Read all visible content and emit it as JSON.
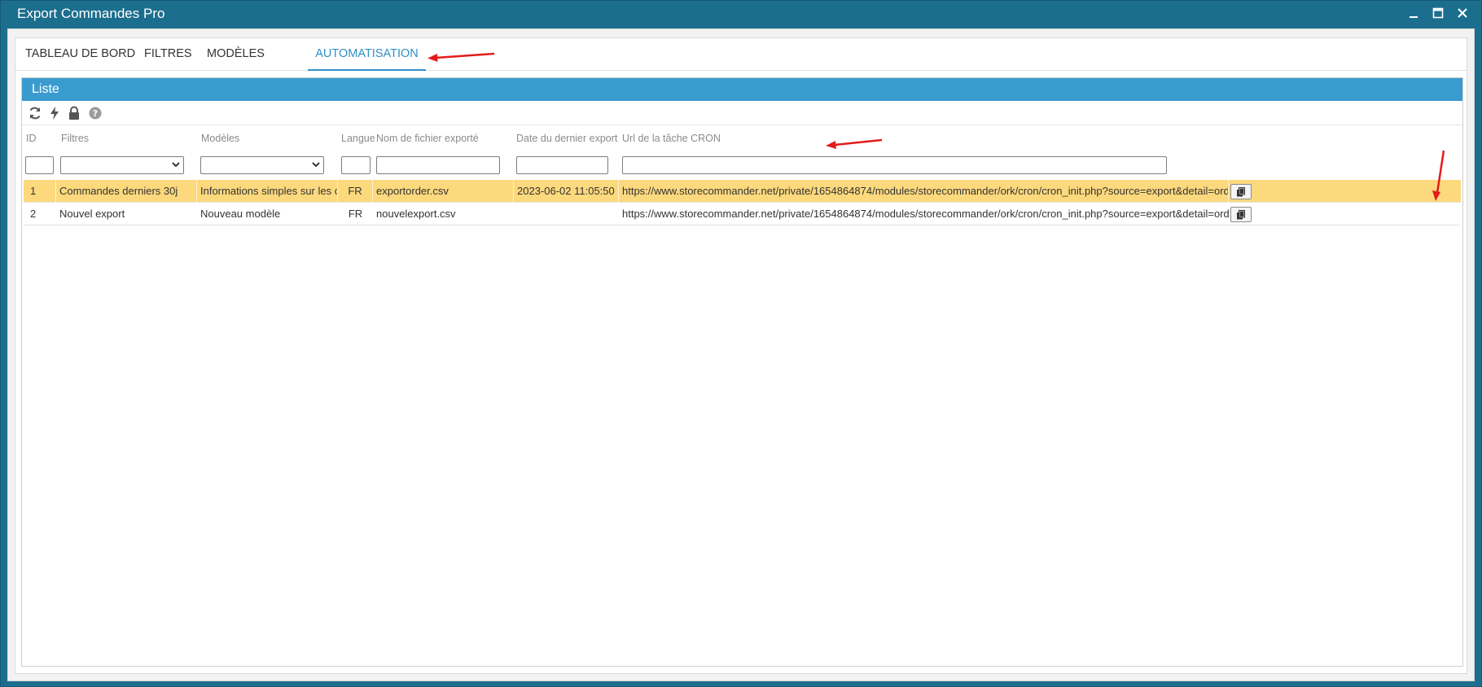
{
  "window": {
    "title": "Export Commandes Pro"
  },
  "tabs": [
    {
      "label": "TABLEAU DE BORD"
    },
    {
      "label": "FILTRES"
    },
    {
      "label": "MODÈLES"
    },
    {
      "label": "AUTOMATISATION"
    }
  ],
  "active_tab": "AUTOMATISATION",
  "liste": {
    "title": "Liste"
  },
  "toolbar": {
    "icons": [
      "refresh-icon",
      "lightning-icon",
      "lock-icon",
      "help-icon"
    ]
  },
  "columns": [
    {
      "label": "ID"
    },
    {
      "label": "Filtres"
    },
    {
      "label": "Modèles"
    },
    {
      "label": "Langue"
    },
    {
      "label": "Nom de fichier exporté"
    },
    {
      "label": "Date du dernier export"
    },
    {
      "label": "Url de la tâche CRON"
    }
  ],
  "rows": [
    {
      "id": "1",
      "filtre": "Commandes derniers 30j",
      "modele": "Informations simples sur les commandes",
      "langue": "FR",
      "fichier": "exportorder.csv",
      "date": "2023-06-02 11:05:50",
      "url": "https://www.storecommander.net/private/1654864874/modules/storecommander/ork/cron/cron_init.php?source=export&detail=orders&process",
      "selected": true
    },
    {
      "id": "2",
      "filtre": "Nouvel export",
      "modele": "Nouveau modèle",
      "langue": "FR",
      "fichier": "nouvelexport.csv",
      "date": "",
      "url": "https://www.storecommander.net/private/1654864874/modules/storecommander/ork/cron/cron_init.php?source=export&detail=orders&process",
      "selected": false
    }
  ],
  "colors": {
    "titlebar": "#1c6e8e",
    "accent": "#3a9bd0",
    "active_tab": "#2e8fc7",
    "selected_row": "#fdd97d",
    "annotation_arrow": "#e31b1b"
  }
}
